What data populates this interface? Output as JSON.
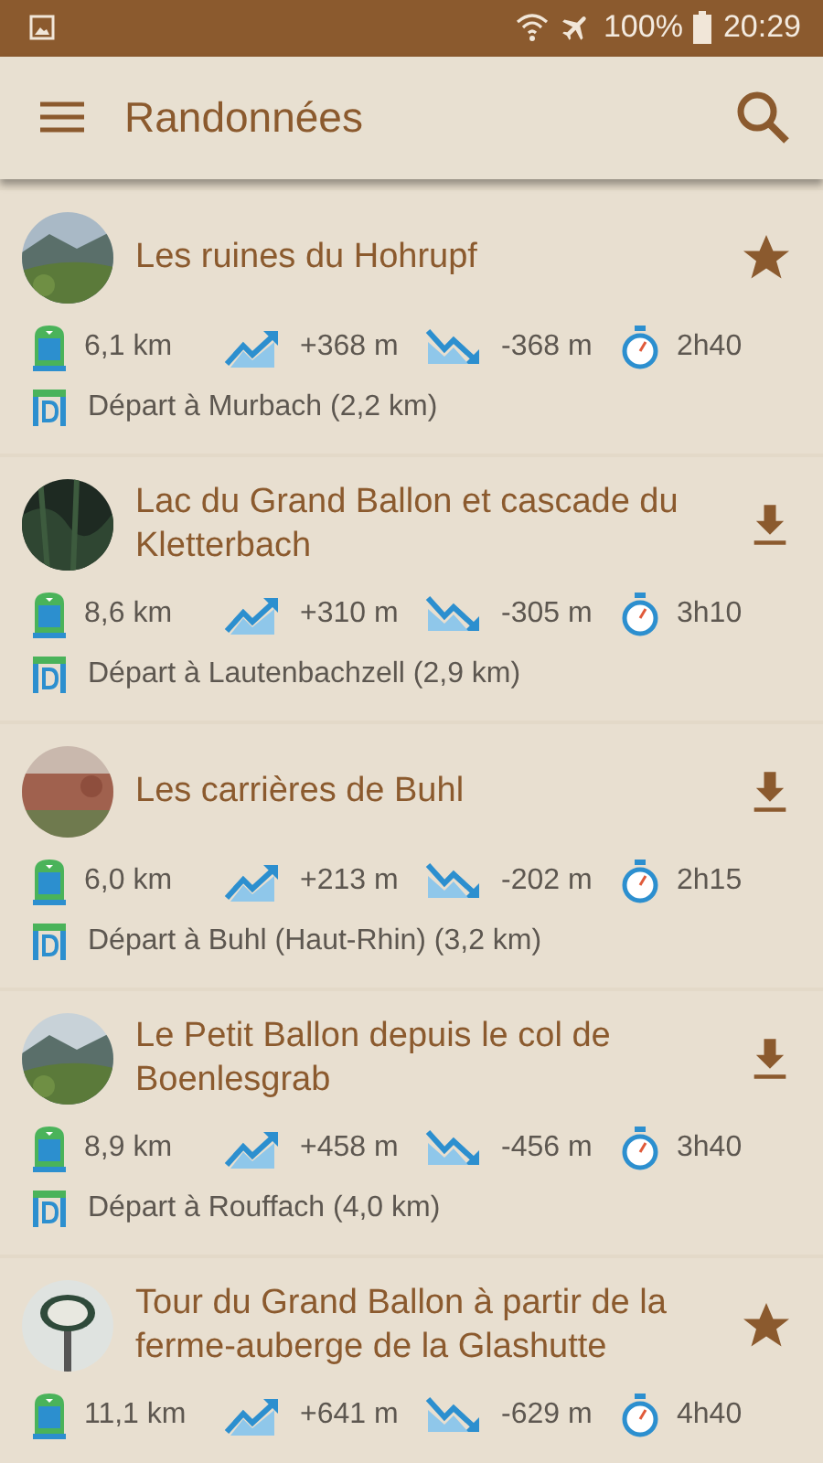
{
  "status_bar": {
    "battery": "100%",
    "time": "20:29"
  },
  "toolbar": {
    "title": "Randonnées"
  },
  "hikes": [
    {
      "title": "Les ruines du Hohrupf",
      "kind": "starred",
      "distance": "6,1 km",
      "ascent": "+368 m",
      "descent": "-368 m",
      "duration": "2h40",
      "start": "Départ à Murbach (2,2 km)"
    },
    {
      "title": "Lac du Grand Ballon et cascade du Kletterbach",
      "kind": "downloadable",
      "distance": "8,6 km",
      "ascent": "+310 m",
      "descent": "-305 m",
      "duration": "3h10",
      "start": "Départ à Lautenbachzell (2,9 km)"
    },
    {
      "title": "Les carrières de Buhl",
      "kind": "downloadable",
      "distance": "6,0 km",
      "ascent": "+213 m",
      "descent": "-202 m",
      "duration": "2h15",
      "start": "Départ à Buhl (Haut-Rhin) (3,2 km)"
    },
    {
      "title": "Le Petit Ballon depuis le col de Boenlesgrab",
      "kind": "downloadable",
      "distance": "8,9 km",
      "ascent": "+458 m",
      "descent": "-456 m",
      "duration": "3h40",
      "start": "Départ à Rouffach (4,0 km)"
    },
    {
      "title": "Tour du Grand Ballon à partir de la ferme-auberge de la Glashutte",
      "kind": "starred",
      "distance": "11,1 km",
      "ascent": "+641 m",
      "descent": "-629 m",
      "duration": "4h40"
    }
  ]
}
